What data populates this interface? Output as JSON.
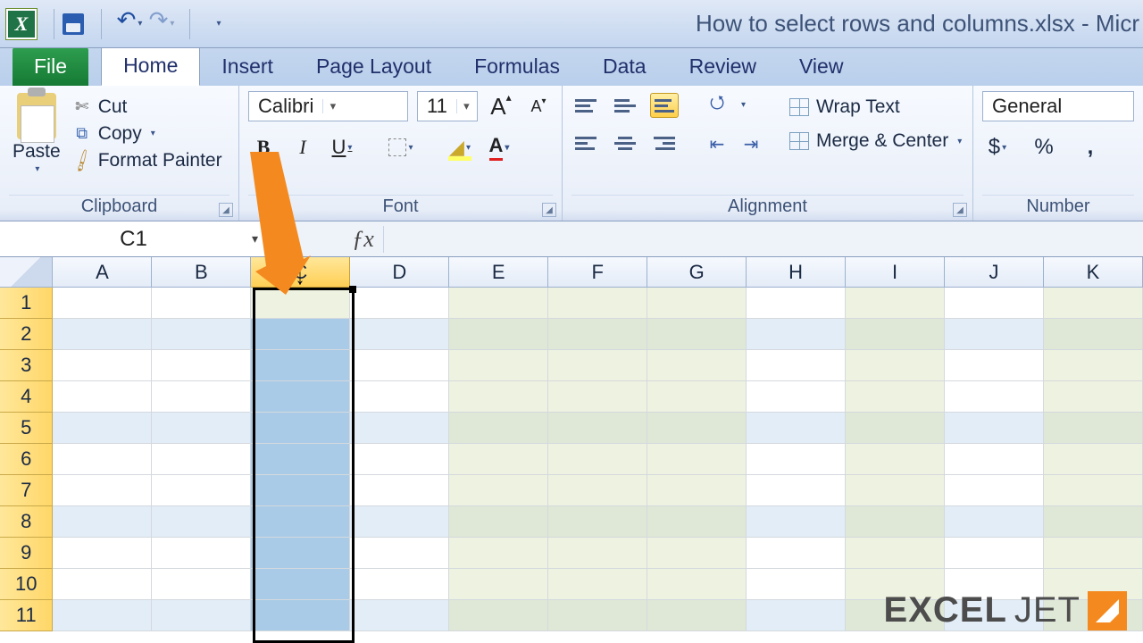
{
  "window": {
    "title": "How to select rows and columns.xlsx - Micr"
  },
  "tabs": {
    "file": "File",
    "home": "Home",
    "insert": "Insert",
    "page_layout": "Page Layout",
    "formulas": "Formulas",
    "data": "Data",
    "review": "Review",
    "view": "View"
  },
  "clipboard": {
    "paste": "Paste",
    "cut": "Cut",
    "copy": "Copy",
    "format_painter": "Format Painter",
    "label": "Clipboard"
  },
  "font": {
    "name": "Calibri",
    "size": "11",
    "increase": "A",
    "decrease": "A",
    "bold": "B",
    "italic": "I",
    "underline": "U",
    "label": "Font",
    "font_color_hex": "#e02020",
    "fill_color_hex": "#ffff66"
  },
  "alignment": {
    "wrap_text": "Wrap Text",
    "merge_center": "Merge & Center",
    "label": "Alignment"
  },
  "number": {
    "format": "General",
    "currency": "$",
    "percent": "%",
    "comma": ",",
    "label": "Number"
  },
  "namebox": {
    "ref": "C1"
  },
  "grid": {
    "columns": [
      "A",
      "B",
      "C",
      "D",
      "E",
      "F",
      "G",
      "H",
      "I",
      "J",
      "K"
    ],
    "rows": [
      "1",
      "2",
      "3",
      "4",
      "5",
      "6",
      "7",
      "8",
      "9",
      "10",
      "11"
    ],
    "selected_column": "C",
    "shaded_columns": [
      "E",
      "F",
      "G",
      "I",
      "K"
    ],
    "banded_rows": [
      2,
      5,
      8,
      11
    ]
  },
  "watermark": {
    "bold": "EXCEL",
    "thin": "JET"
  },
  "colors": {
    "ribbon_orange": "#f48a1f",
    "sel_header": "#ffcf55",
    "sel_cells": "#a9cbe7"
  }
}
